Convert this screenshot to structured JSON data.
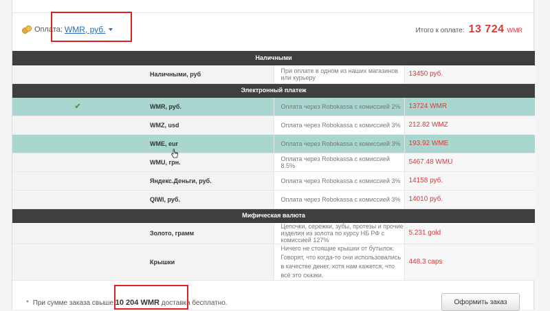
{
  "payment": {
    "label": "Оплата:",
    "selected": "WMR, руб."
  },
  "total": {
    "label": "Итого к оплате:",
    "amount": "13 724",
    "currency": "WMR"
  },
  "sections": [
    {
      "title": "Наличными"
    },
    {
      "title": "Электронный платеж"
    },
    {
      "title": "Мифическая валюта"
    }
  ],
  "rows": [
    {
      "name": "Наличными, руб",
      "desc": "При оплате в одном из наших магазинов или курьеру",
      "price": "13450 руб."
    },
    {
      "name": "WMR, руб.",
      "desc": "Оплата через Robokassa с комиссией 2%",
      "price": "13724 WMR",
      "selected": true
    },
    {
      "name": "WMZ, usd",
      "desc": "Оплата через Robokassa с комиссией 3%",
      "price": "212.82 WMZ"
    },
    {
      "name": "WME, eur",
      "desc": "Оплата через Robokassa с комиссией 3%",
      "price": "193.92 WME"
    },
    {
      "name": "WMU, грн.",
      "desc": "Оплата через Robokassa с комиссией 8.5%",
      "price": "5467.48 WMU"
    },
    {
      "name": "Яндекс.Деньги, руб.",
      "desc": "Оплата через Robokassa с комиссией 3%",
      "price": "14158 руб."
    },
    {
      "name": "QIWI, руб.",
      "desc": "Оплата через Robokassa с комиссией 3%",
      "price": "14010 руб."
    },
    {
      "name": "Золото, грамм",
      "desc": "Цепочки, сережки, зубы, протезы и прочие изделия из золота по курсу НБ РФ с комиссией 127%",
      "price": "5.231 gold"
    },
    {
      "name": "Крышки",
      "desc": "Ничего не стоящие крышки от бутылок. Говорят, что когда-то они использовались в качестве денег, хотя нам кажется, что всё это сказки.",
      "price": "448.3 caps"
    }
  ],
  "footer": {
    "note_prefix": "При сумме заказа свыше",
    "threshold": "10 204 WMR",
    "note_suffix": "доставка бесплатно.",
    "order_button": "Оформить заказ"
  },
  "colors": {
    "accent_red": "#d43a3a",
    "link_blue": "#2a6db0",
    "highlight": "#a9d7d0",
    "section_bg": "#3f3f3f"
  },
  "icons": [
    "coins-icon",
    "caret-down-icon",
    "check-icon",
    "hand-cursor-icon"
  ]
}
